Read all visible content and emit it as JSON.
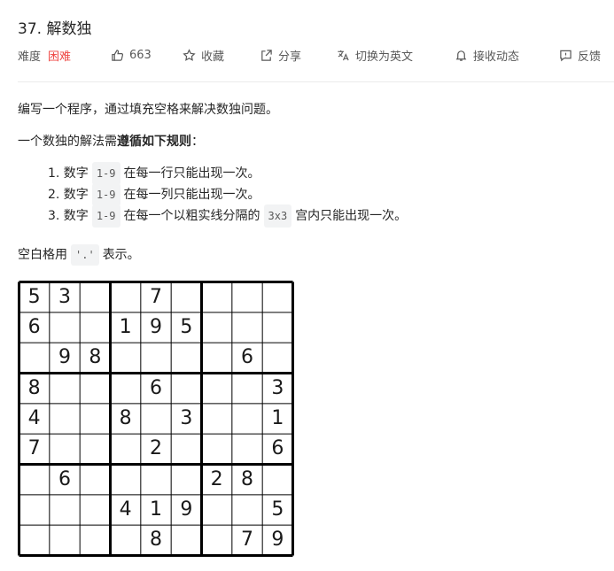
{
  "problem": {
    "title": "37. 解数独"
  },
  "meta": {
    "difficulty_label": "难度",
    "difficulty_value": "困难",
    "likes": "663",
    "collect": "收藏",
    "share": "分享",
    "switch_lang": "切换为英文",
    "notify": "接收动态",
    "feedback": "反馈",
    "colors": {
      "hard": "#ef4743",
      "text": "#595959"
    }
  },
  "description": {
    "p1": "编写一个程序，通过填充空格来解决数独问题。",
    "p2_prefix": "一个数独的解法需",
    "p2_bold": "遵循如下规则",
    "p2_suffix": "：",
    "rules": [
      {
        "prefix": "1. 数字",
        "code": "1-9",
        "suffix": "在每一行只能出现一次。"
      },
      {
        "prefix": "2. 数字",
        "code": "1-9",
        "suffix": "在每一列只能出现一次。"
      },
      {
        "prefix": "3. 数字",
        "code": "1-9",
        "middle": "在每一个以粗实线分隔的",
        "code2": "3x3",
        "suffix": "宫内只能出现一次。"
      }
    ],
    "p3_prefix": "空白格用",
    "p3_code": "'.'",
    "p3_suffix": "表示。"
  },
  "board": [
    [
      "5",
      "3",
      "",
      "",
      "7",
      "",
      "",
      "",
      ""
    ],
    [
      "6",
      "",
      "",
      "1",
      "9",
      "5",
      "",
      "",
      ""
    ],
    [
      "",
      "9",
      "8",
      "",
      "",
      "",
      "",
      "6",
      ""
    ],
    [
      "8",
      "",
      "",
      "",
      "6",
      "",
      "",
      "",
      "3"
    ],
    [
      "4",
      "",
      "",
      "8",
      "",
      "3",
      "",
      "",
      "1"
    ],
    [
      "7",
      "",
      "",
      "",
      "2",
      "",
      "",
      "",
      "6"
    ],
    [
      "",
      "6",
      "",
      "",
      "",
      "",
      "2",
      "8",
      ""
    ],
    [
      "",
      "",
      "",
      "4",
      "1",
      "9",
      "",
      "",
      "5"
    ],
    [
      "",
      "",
      "",
      "",
      "8",
      "",
      "",
      "7",
      "9"
    ]
  ]
}
